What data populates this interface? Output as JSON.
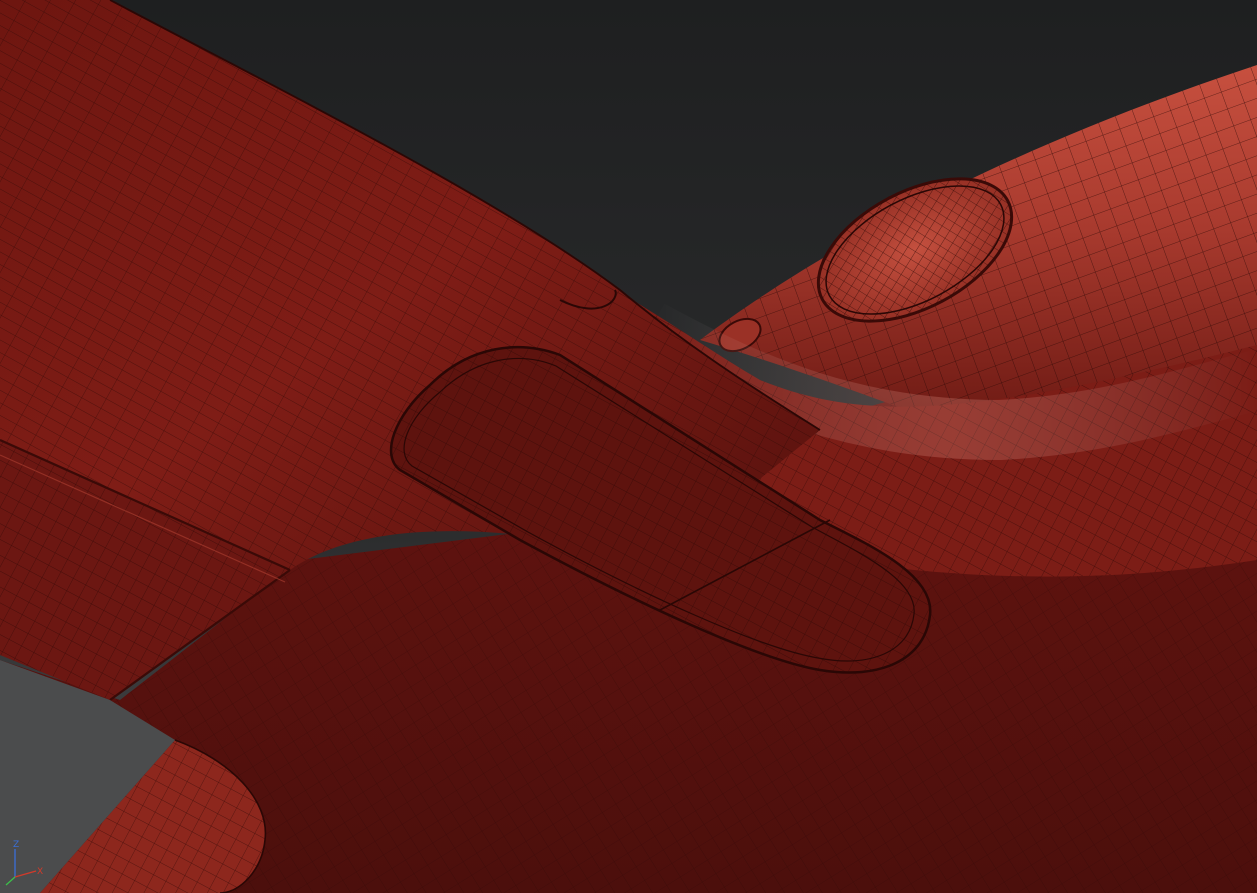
{
  "viewport": {
    "background_top": "#1f2021",
    "background_bottom": "#4a4b4c",
    "mesh_base_color": "#7a1c16",
    "mesh_light_color": "#b3473b",
    "mesh_dark_color": "#4a0f0c",
    "wire_color": "#2a0705"
  },
  "gizmo": {
    "x_label": "X",
    "y_label": "Y",
    "z_label": "Z",
    "x_color": "#d23a2a",
    "y_color": "#3cbf4a",
    "z_color": "#3a6fd8"
  }
}
